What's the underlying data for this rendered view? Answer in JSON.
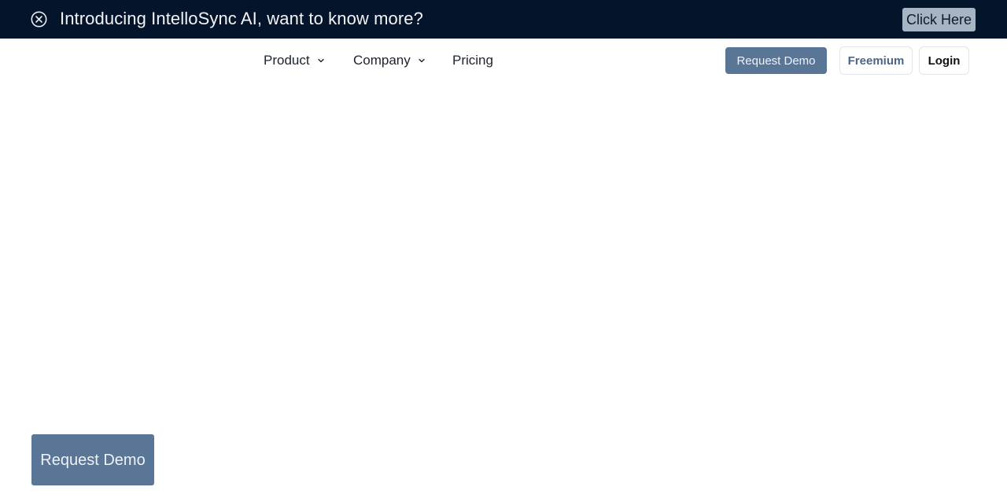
{
  "banner": {
    "close_icon": "circle-x-icon",
    "text": "Introducing IntelloSync AI, want to know more?",
    "cta_label": "Click Here",
    "background": "#04142a"
  },
  "nav": {
    "items": [
      {
        "label": "Product",
        "has_dropdown": true,
        "icon": "chevron-down-icon"
      },
      {
        "label": "Company",
        "has_dropdown": true,
        "icon": "chevron-down-icon"
      },
      {
        "label": "Pricing",
        "has_dropdown": false
      }
    ]
  },
  "header_actions": {
    "request_demo_label": "Request Demo",
    "freemium_label": "Freemium",
    "login_label": "Login",
    "accent": "#5a7696"
  },
  "floating": {
    "request_demo_label": "Request Demo"
  }
}
